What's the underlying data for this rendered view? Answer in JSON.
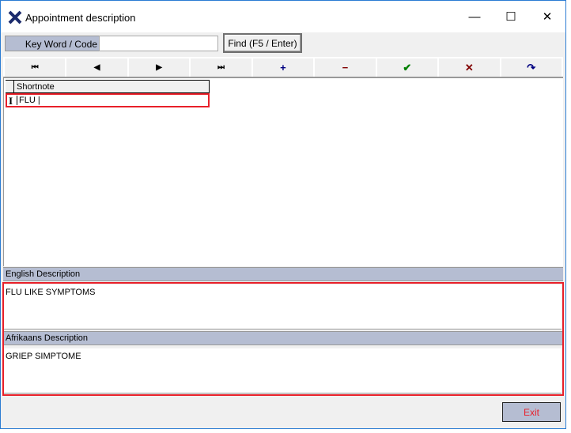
{
  "window": {
    "title": "Appointment description",
    "minimize": "—",
    "maximize": "☐",
    "close": "✕"
  },
  "search": {
    "label": "Key Word / Code",
    "value": "",
    "find_label": "Find (F5 / Enter)"
  },
  "nav": {
    "first": "⏮",
    "prev": "◀",
    "next": "▶",
    "last": "⏭",
    "add": "+",
    "delete": "−",
    "post": "✔",
    "cancel": "✕",
    "refresh": "↷"
  },
  "colors": {
    "header": "#b5bdd2",
    "highlight": "#e8202a"
  },
  "grid": {
    "column": "Shortnote",
    "row_indicator": "I",
    "rows": [
      {
        "shortnote": "FLU |"
      }
    ]
  },
  "english": {
    "label": "English Description",
    "value": "FLU LIKE SYMPTOMS"
  },
  "afrikaans": {
    "label": "Afrikaans Description",
    "value": "GRIEP SIMPTOME"
  },
  "exit_label": "Exit"
}
